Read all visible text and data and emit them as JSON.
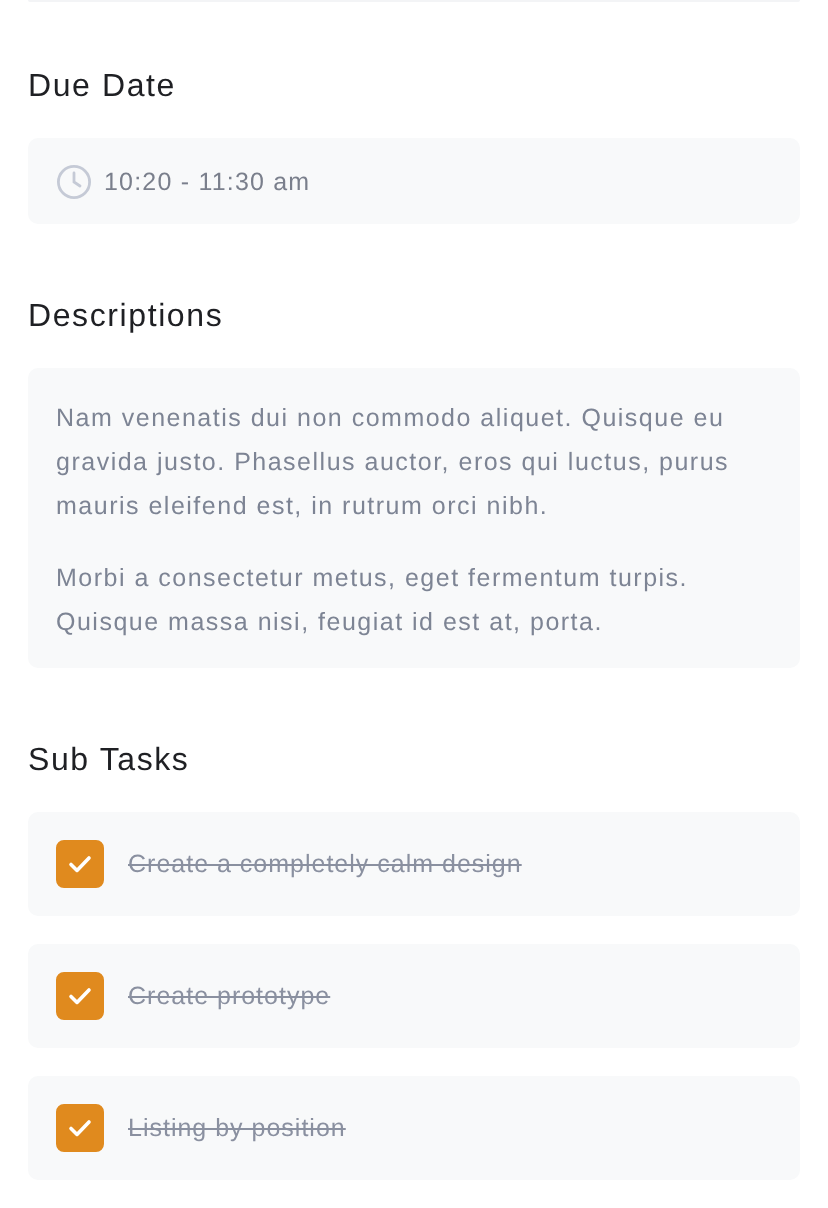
{
  "due_date": {
    "heading": "Due Date",
    "value": "10:20 - 11:30 am"
  },
  "descriptions": {
    "heading": "Descriptions",
    "paragraphs": [
      "Nam venenatis dui non commodo aliquet. Quisque eu gravida justo. Phasellus auctor, eros qui luctus, purus mauris eleifend est, in rutrum orci nibh.",
      "Morbi a consectetur metus, eget fermentum turpis. Quisque massa nisi, feugiat id est at, porta."
    ]
  },
  "sub_tasks": {
    "heading": "Sub Tasks",
    "items": [
      {
        "label": "Create a completely calm design",
        "checked": true
      },
      {
        "label": "Create prototype",
        "checked": true
      },
      {
        "label": "Listing by position",
        "checked": true
      }
    ]
  }
}
